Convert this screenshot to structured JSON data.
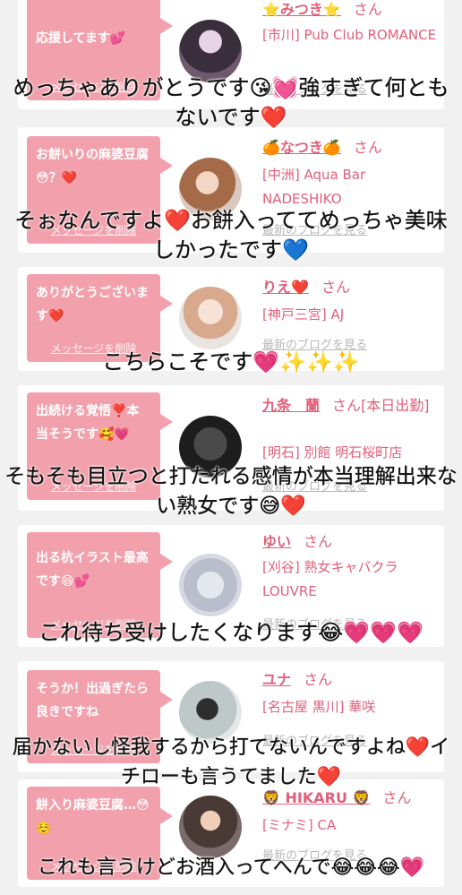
{
  "colors": {
    "accent": "#e0607a",
    "bubble": "#f2a1ac",
    "blog_link": "#b7b7b7",
    "page_bg": "#f1f1f1"
  },
  "delete_label": "メッセージを削除",
  "blog_label": "最新のブログを見る",
  "san_label": "さん",
  "messages": [
    {
      "bubble": "応援してます💕",
      "name": "⭐️みつき⭐️",
      "shop": "[市川] Pub Club ROMANCE",
      "avatar_icon": "avatar-photo"
    },
    {
      "bubble": "お餅いりの麻婆豆腐😳？❤️",
      "name": "🍊なつき🍊",
      "shop": "[中洲] Aqua Bar NADESHIKO",
      "avatar_icon": "avatar-photo"
    },
    {
      "bubble": "ありがとうございます❤️",
      "name": "りえ❤️",
      "shop": "[神戸三宮] AJ",
      "avatar_icon": "avatar-photo"
    },
    {
      "bubble": "出続ける覚悟❣️本当そうです🥰💗",
      "name": "九条　蘭",
      "name_suffix": "[本日出勤]",
      "shop": "[明石] 別館 明石桜町店",
      "avatar_icon": "avatar-photo"
    },
    {
      "bubble": "出る杭イラスト最高です😆💕",
      "name": "ゆい",
      "shop": "[刈谷] 熟女キャバクラ LOUVRE",
      "avatar_icon": "avatar-photo"
    },
    {
      "bubble": "そうか！出過ぎたら良きですね",
      "name": "ユナ",
      "shop": "[名古屋 黒川] 華咲",
      "avatar_icon": "avatar-photo"
    },
    {
      "bubble": "餅入り麻婆豆腐…😳☺️",
      "name": "🦁 HIKARU 🦁",
      "shop": "[ミナミ] CA",
      "avatar_icon": "avatar-photo"
    }
  ],
  "captions": [
    "めっちゃありがとうです😘💓強すぎて何ともないです❤️",
    "そぉなんですよ❤️お餅入っててめっちゃ美味しかったです💙",
    "こちらこそです💗✨✨✨",
    "そもそも目立つと打たれる感情が本当理解出来ない熟女です😅❤️",
    "これ待ち受けしたくなります😂💗💗💗",
    "届かないし怪我するから打てないんですよね❤️イチローも言うてました❤️",
    "これも言うけどお酒入ってへんで😂😂😂💗"
  ]
}
